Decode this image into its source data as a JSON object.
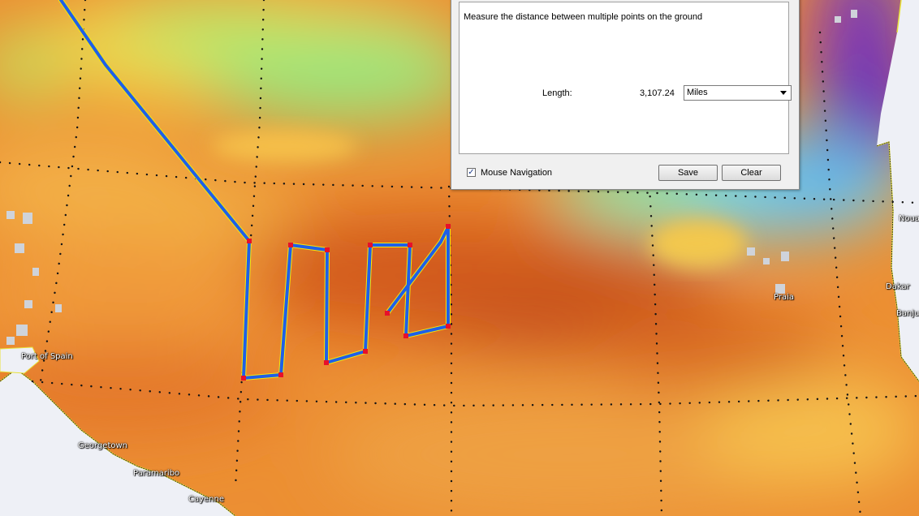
{
  "ruler": {
    "description": "Measure the distance between multiple points on the ground",
    "length_label": "Length:",
    "length_value": "3,107.24",
    "unit_selected": "Miles",
    "mouse_nav_label": "Mouse Navigation",
    "mouse_nav_checked": true,
    "save_label": "Save",
    "clear_label": "Clear"
  },
  "places": {
    "port_of_spain": "Port of Spain",
    "georgetown": "Georgetown",
    "paramaribo": "Paramaribo",
    "cayenne": "Cayenne",
    "praia": "Praia",
    "dakar": "Dakar",
    "nouak": "Nouak",
    "banjul": "Banju"
  },
  "colors": {
    "path": "#1f5fe8",
    "vertex": "#e8102a",
    "yellow_trace": "#f5e80a",
    "grid_dots": "#1a1a1a"
  }
}
